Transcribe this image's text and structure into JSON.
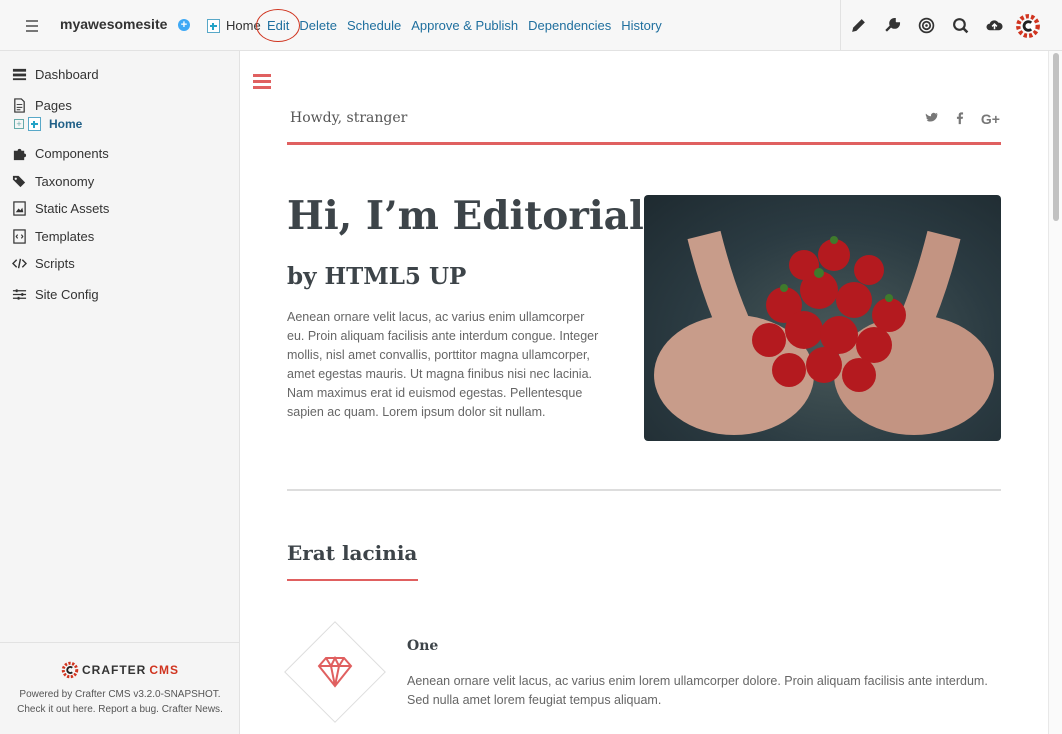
{
  "toolbar": {
    "site_name": "myawesomesite",
    "breadcrumb_home": "Home",
    "actions": [
      "Edit",
      "Delete",
      "Schedule",
      "Approve & Publish",
      "Dependencies",
      "History"
    ],
    "tools": [
      "pencil-icon",
      "wrench-icon",
      "target-icon",
      "search-icon",
      "cloud-upload-icon",
      "crafter-logo-icon"
    ]
  },
  "sidebar": {
    "items": [
      {
        "label": "Dashboard",
        "icon": "dashboard-icon"
      },
      {
        "label": "Pages",
        "icon": "pages-icon"
      },
      {
        "label": "Components",
        "icon": "puzzle-icon"
      },
      {
        "label": "Taxonomy",
        "icon": "tags-icon"
      },
      {
        "label": "Static Assets",
        "icon": "image-icon"
      },
      {
        "label": "Templates",
        "icon": "template-icon"
      },
      {
        "label": "Scripts",
        "icon": "code-icon"
      },
      {
        "label": "Site Config",
        "icon": "sliders-icon"
      }
    ],
    "tree_home": "Home",
    "logo_text": "CRAFTER",
    "logo_cms": "CMS",
    "powered_line1": "Powered by Crafter CMS v3.2.0-SNAPSHOT.",
    "powered_line2_a": "Check it out ",
    "link_here": "here",
    "powered_line2_b": ". Report a ",
    "link_bug": "bug",
    "powered_line2_c": ". ",
    "link_news": "Crafter News",
    "powered_line2_d": "."
  },
  "preview": {
    "greeting": "Howdy, stranger",
    "hero_title": "Hi, I’m Editorial",
    "hero_subtitle": "by HTML5 UP",
    "hero_text": "Aenean ornare velit lacus, ac varius enim ullamcorper eu. Proin aliquam facilisis ante interdum congue. Integer mollis, nisl amet convallis, porttitor magna ullamcorper, amet egestas mauris. Ut magna finibus nisi nec lacinia. Nam maximus erat id euismod egestas. Pellentesque sapien ac quam. Lorem ipsum dolor sit nullam.",
    "section_title": "Erat lacinia",
    "feature_title": "One",
    "feature_text": "Aenean ornare velit lacus, ac varius enim lorem ullamcorper dolore. Proin aliquam facilisis ante interdum. Sed nulla amet lorem feugiat tempus aliquam."
  },
  "colors": {
    "accent": "#e06060",
    "link": "#1f6f9e",
    "annotation_circle": "#d0341f"
  }
}
